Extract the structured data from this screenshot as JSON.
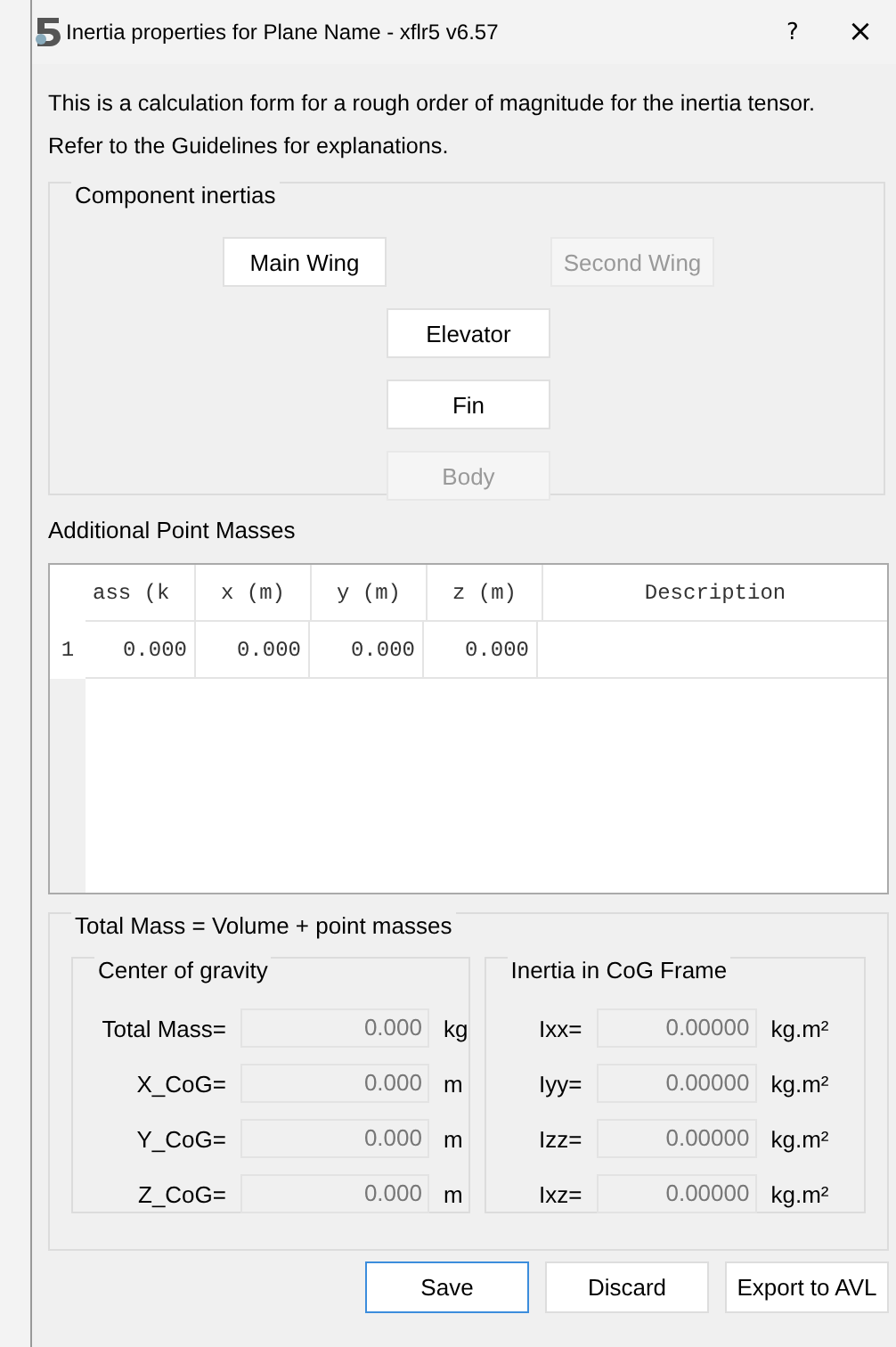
{
  "window": {
    "title": "Inertia properties for Plane Name - xflr5 v6.57",
    "help": "?",
    "close": "×"
  },
  "intro": [
    "This is a calculation form for a rough order of magnitude for the inertia tensor.",
    "Refer to the Guidelines for explanations."
  ],
  "component_inertias": {
    "title": "Component inertias",
    "buttons": [
      {
        "label": "Main Wing",
        "disabled": false
      },
      {
        "label": "Second Wing",
        "disabled": true
      },
      {
        "label": "Elevator",
        "disabled": false
      },
      {
        "label": "Fin",
        "disabled": false
      },
      {
        "label": "Body",
        "disabled": true
      }
    ]
  },
  "point_masses": {
    "title": "Additional Point Masses",
    "columns": [
      "ass (k",
      "x (m)",
      "y (m)",
      "z (m)",
      "Description"
    ],
    "rows": [
      {
        "number": "1",
        "cells": [
          "0.000",
          "0.000",
          "0.000",
          "0.000",
          ""
        ]
      }
    ]
  },
  "totals": {
    "title": "Total Mass = Volume + point masses",
    "cog": {
      "title": "Center of gravity",
      "rows": [
        {
          "label": "Total Mass=",
          "value": "0.000",
          "unit": "kg"
        },
        {
          "label": "X_CoG=",
          "value": "0.000",
          "unit": "m"
        },
        {
          "label": "Y_CoG=",
          "value": "0.000",
          "unit": "m"
        },
        {
          "label": "Z_CoG=",
          "value": "0.000",
          "unit": "m"
        }
      ]
    },
    "inertia": {
      "title": "Inertia in CoG Frame",
      "rows": [
        {
          "label": "Ixx=",
          "value": "0.00000",
          "unit": "kg.m²"
        },
        {
          "label": "Iyy=",
          "value": "0.00000",
          "unit": "kg.m²"
        },
        {
          "label": "Izz=",
          "value": "0.00000",
          "unit": "kg.m²"
        },
        {
          "label": "Ixz=",
          "value": "0.00000",
          "unit": "kg.m²"
        }
      ]
    }
  },
  "buttons": [
    {
      "label": "Save",
      "default": true
    },
    {
      "label": "Discard",
      "default": false
    },
    {
      "label": "Export to AVL",
      "default": false
    }
  ]
}
